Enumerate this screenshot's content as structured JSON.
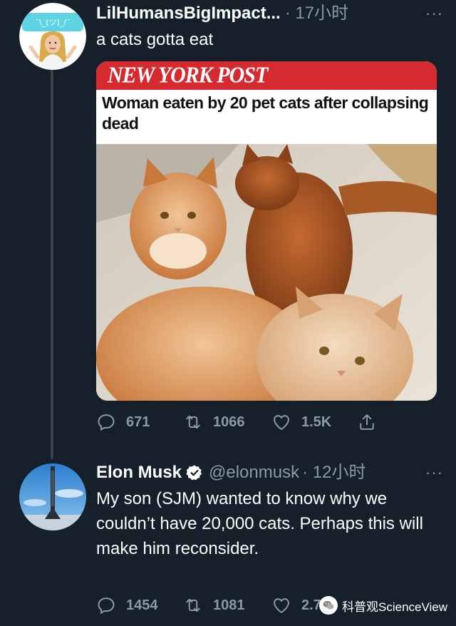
{
  "tweets": [
    {
      "display_name": "LilHumansBigImpact...",
      "meta": "· 17小时",
      "more": "···",
      "text": "a cats gotta eat",
      "media": {
        "logo": "NEW YORK POST",
        "headline": "Woman eaten by 20 pet cats after collapsing dead"
      },
      "actions": {
        "replies": "671",
        "retweets": "1066",
        "likes": "1.5K"
      },
      "avatar_icon": "bitmoji-avatar-icon",
      "avatar_bubble_text": "¯\\_(ツ)_/¯"
    },
    {
      "display_name": "Elon Musk",
      "handle": "@elonmusk",
      "time": "· 12小时",
      "more": "···",
      "verified": true,
      "text": "My son (SJM) wanted to know why we couldn’t have 20,000 cats. Perhaps this will make him reconsider.",
      "actions": {
        "replies": "1454",
        "retweets": "1081",
        "likes": "2.7"
      },
      "avatar_icon": "rocket-launch-avatar-icon"
    }
  ],
  "watermark": {
    "text": "科普观ScienceView",
    "icon": "wechat-icon"
  },
  "colors": {
    "background": "#15202b",
    "secondary_text": "#8b98a5",
    "verified": "#ffffff",
    "banner_red": "#d52a2f"
  }
}
